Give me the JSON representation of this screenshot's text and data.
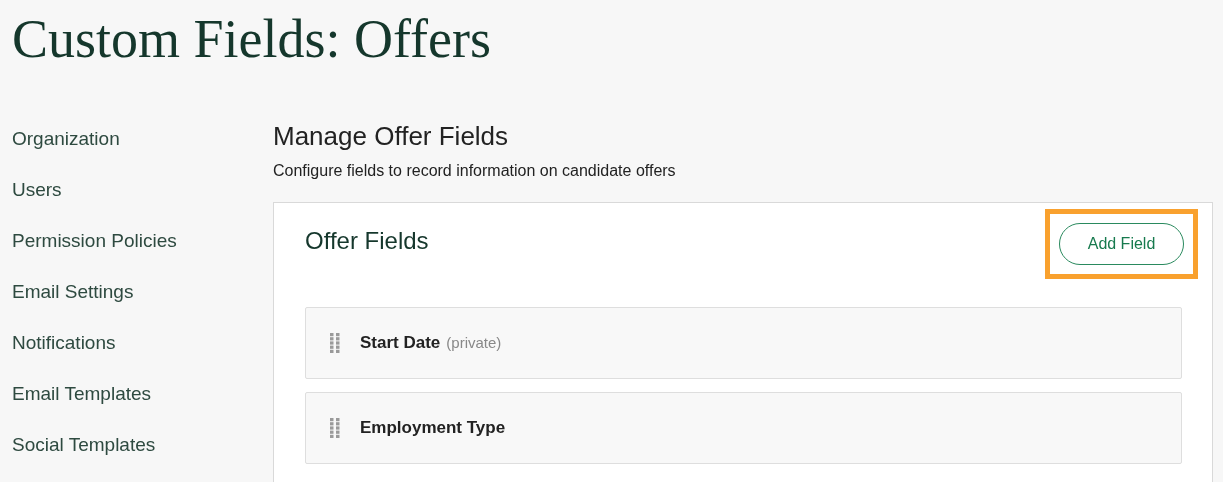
{
  "page_title": "Custom Fields: Offers",
  "sidebar": {
    "items": [
      {
        "label": "Organization"
      },
      {
        "label": "Users"
      },
      {
        "label": "Permission Policies"
      },
      {
        "label": "Email Settings"
      },
      {
        "label": "Notifications"
      },
      {
        "label": "Email Templates"
      },
      {
        "label": "Social Templates"
      }
    ]
  },
  "section": {
    "title": "Manage Offer Fields",
    "description": "Configure fields to record information on candidate offers"
  },
  "card": {
    "title": "Offer Fields",
    "button": {
      "label": "Add Field",
      "highlighted": true
    },
    "fields": [
      {
        "name": "Start Date",
        "note": "(private)"
      },
      {
        "name": "Employment Type"
      }
    ]
  }
}
